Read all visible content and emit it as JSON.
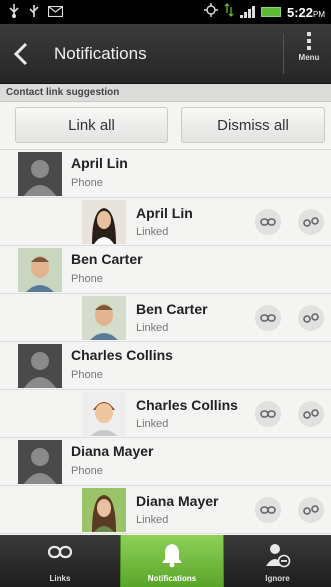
{
  "status_bar": {
    "time": "5:22",
    "time_suffix": "PM",
    "left_icons": [
      "usb-icon",
      "usb-debug-icon",
      "mail-icon"
    ],
    "right_icons": [
      "gps-icon",
      "data-icon",
      "signal-icon",
      "battery-icon"
    ]
  },
  "action_bar": {
    "title": "Notifications",
    "menu_label": "Menu"
  },
  "section": {
    "header": "Contact link suggestion",
    "link_all_label": "Link all",
    "dismiss_all_label": "Dismiss all"
  },
  "contacts": [
    {
      "name": "April Lin",
      "source": "Phone",
      "linked_name": "April Lin",
      "linked_status": "Linked"
    },
    {
      "name": "Ben Carter",
      "source": "Phone",
      "linked_name": "Ben Carter",
      "linked_status": "Linked"
    },
    {
      "name": "Charles Collins",
      "source": "Phone",
      "linked_name": "Charles Collins",
      "linked_status": "Linked"
    },
    {
      "name": "Diana Mayer",
      "source": "Phone",
      "linked_name": "Diana Mayer",
      "linked_status": "Linked"
    }
  ],
  "bottom_tabs": [
    {
      "label": "Links",
      "icon": "link-icon"
    },
    {
      "label": "Notifications",
      "icon": "bell-icon",
      "selected": true
    },
    {
      "label": "Ignore",
      "icon": "ignore-person-icon"
    }
  ],
  "colors": {
    "accent_green": "#6bb83a",
    "action_bar": "#2f2f2f",
    "background": "#f4f4f2"
  }
}
